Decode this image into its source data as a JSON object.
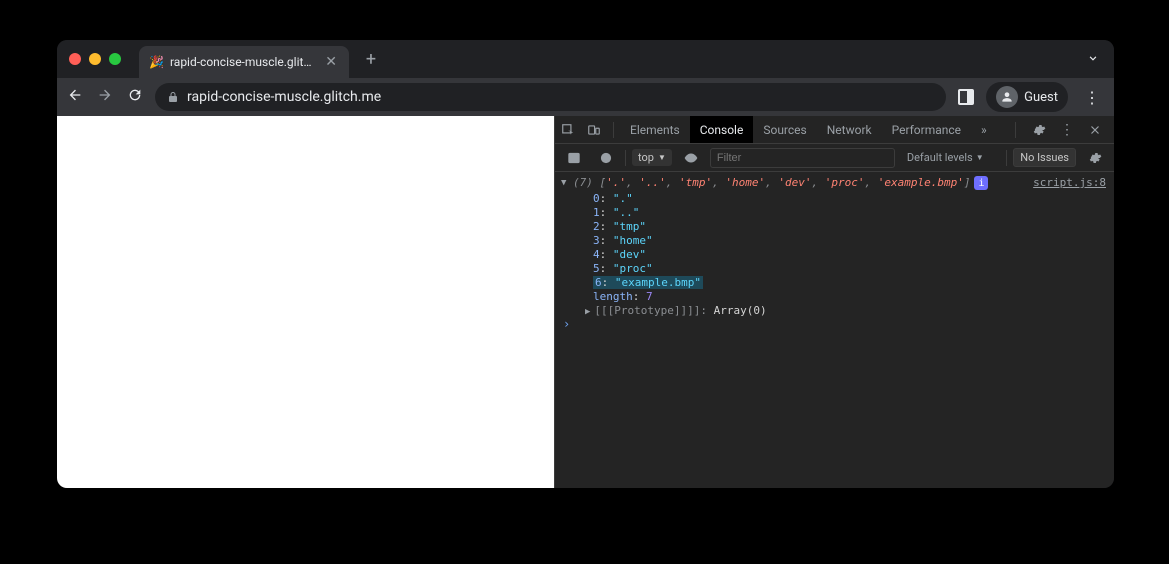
{
  "window": {
    "tab_title": "rapid-concise-muscle.glitch.m",
    "favicon_emoji": "🎉"
  },
  "toolbar": {
    "url": "rapid-concise-muscle.glitch.me",
    "profile_label": "Guest"
  },
  "devtools": {
    "tabs": {
      "elements": "Elements",
      "console": "Console",
      "sources": "Sources",
      "network": "Network",
      "performance": "Performance",
      "more": "»"
    },
    "subbar": {
      "context": "top",
      "filter_placeholder": "Filter",
      "levels": "Default levels",
      "issues": "No Issues"
    },
    "log": {
      "count": "(7)",
      "preview_items": [
        "'.'",
        "'..'",
        "'tmp'",
        "'home'",
        "'dev'",
        "'proc'",
        "'example.bmp'"
      ],
      "source": "script.js:8",
      "items": [
        {
          "idx": "0",
          "val": "\".\""
        },
        {
          "idx": "1",
          "val": "\"..\""
        },
        {
          "idx": "2",
          "val": "\"tmp\""
        },
        {
          "idx": "3",
          "val": "\"home\""
        },
        {
          "idx": "4",
          "val": "\"dev\""
        },
        {
          "idx": "5",
          "val": "\"proc\""
        },
        {
          "idx": "6",
          "val": "\"example.bmp\"",
          "highlight": true
        }
      ],
      "length_label": "length",
      "length_val": "7",
      "proto_label": "[[Prototype]]",
      "proto_val": "Array(0)"
    }
  }
}
